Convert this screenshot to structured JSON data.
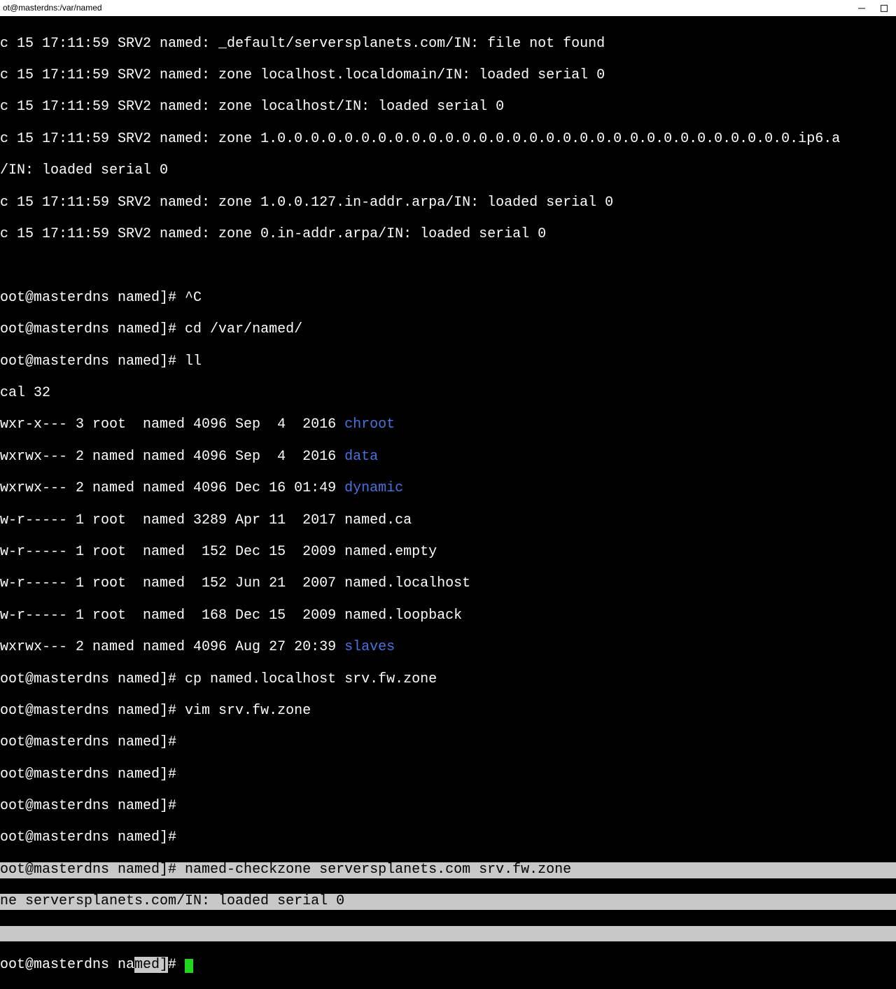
{
  "window": {
    "title": "ot@masterdns:/var/named",
    "minimize": "–",
    "maximize": "□"
  },
  "log": {
    "l1": "c 15 17:11:59 SRV2 named: _default/serversplanets.com/IN: file not found",
    "l2": "c 15 17:11:59 SRV2 named: zone localhost.localdomain/IN: loaded serial 0",
    "l3": "c 15 17:11:59 SRV2 named: zone localhost/IN: loaded serial 0",
    "l4": "c 15 17:11:59 SRV2 named: zone 1.0.0.0.0.0.0.0.0.0.0.0.0.0.0.0.0.0.0.0.0.0.0.0.0.0.0.0.0.0.0.0.ip6.a",
    "l5": "/IN: loaded serial 0",
    "l6": "c 15 17:11:59 SRV2 named: zone 1.0.0.127.in-addr.arpa/IN: loaded serial 0",
    "l7": "c 15 17:11:59 SRV2 named: zone 0.in-addr.arpa/IN: loaded serial 0"
  },
  "prompt": "oot@masterdns named]# ",
  "cmd": {
    "c1": "^C",
    "c2": "cd /var/named/",
    "c3": "ll",
    "c4": "cp named.localhost srv.fw.zone",
    "c5": "vim srv.fw.zone",
    "c6": "named-checkzone serversplanets.com srv.fw.zone"
  },
  "ll": {
    "total": "cal 32",
    "r1a": "wxr-x--- 3 root  named 4096 Sep  4  2016 ",
    "r1b": "chroot",
    "r2a": "wxrwx--- 2 named named 4096 Sep  4  2016 ",
    "r2b": "data",
    "r3a": "wxrwx--- 2 named named 4096 Dec 16 01:49 ",
    "r3b": "dynamic",
    "r4": "w-r----- 1 root  named 3289 Apr 11  2017 named.ca",
    "r5": "w-r----- 1 root  named  152 Dec 15  2009 named.empty",
    "r6": "w-r----- 1 root  named  152 Jun 21  2007 named.localhost",
    "r7": "w-r----- 1 root  named  168 Dec 15  2009 named.loopback",
    "r8a": "wxrwx--- 2 named named 4096 Aug 27 20:39 ",
    "r8b": "slaves"
  },
  "out": {
    "check": "ne serversplanets.com/IN: loaded serial 0"
  },
  "last": {
    "pre": "oot@masterdns na",
    "mid": "med]",
    "post": "# "
  }
}
